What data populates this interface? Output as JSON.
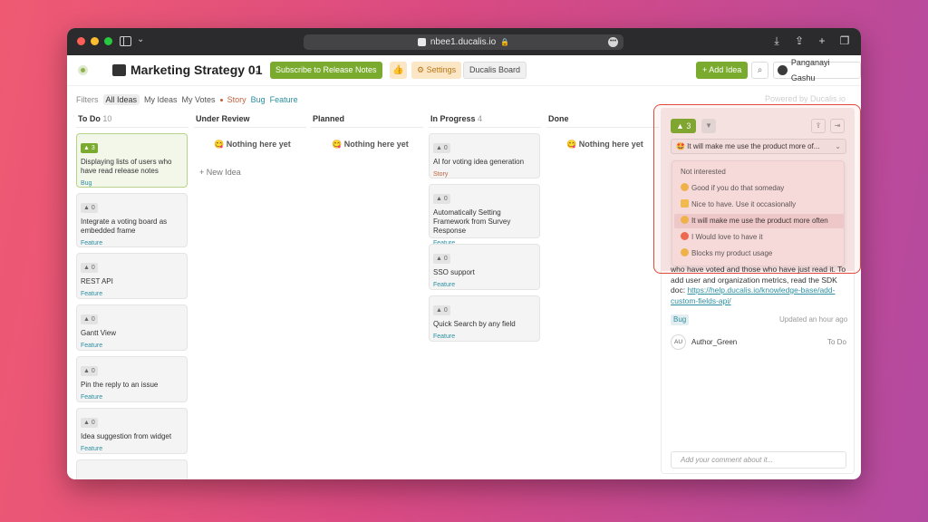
{
  "browser": {
    "url": "nbee1.ducalis.io",
    "light_colors": [
      "#ff5f57",
      "#febc2e",
      "#28c840"
    ]
  },
  "header": {
    "board_title": "Marketing Strategy 01",
    "subscribe_label": "Subscribe to Release Notes",
    "settings_label": "Settings",
    "ducalis_board_label": "Ducalis Board",
    "add_idea_label": "+ Add Idea",
    "user_name": "Panganayi Gashu"
  },
  "filters": {
    "label": "Filters",
    "all_ideas": "All Ideas",
    "my_ideas": "My Ideas",
    "my_votes": "My Votes",
    "story": "Story",
    "bug": "Bug",
    "feature": "Feature",
    "powered_by": "Powered by  Ducalis.io"
  },
  "columns": {
    "todo": {
      "title": "To Do",
      "count": "10"
    },
    "under_review": {
      "title": "Under Review",
      "count": ""
    },
    "planned": {
      "title": "Planned",
      "count": ""
    },
    "in_progress": {
      "title": "In Progress",
      "count": "4"
    },
    "done": {
      "title": "Done",
      "count": ""
    }
  },
  "empty_label": "😋 Nothing here yet",
  "new_idea_label": "+  New Idea",
  "todo_cards": [
    {
      "votes": "▲ 3",
      "title": "Displaying lists of users who have read release notes",
      "tag": "Bug"
    },
    {
      "votes": "▲ 0",
      "title": "Integrate a voting board as embedded frame",
      "tag": "Feature"
    },
    {
      "votes": "▲ 0",
      "title": "REST API",
      "tag": "Feature"
    },
    {
      "votes": "▲ 0",
      "title": "Gantt View",
      "tag": "Feature"
    },
    {
      "votes": "▲ 0",
      "title": "Pin the reply to an issue",
      "tag": "Feature"
    },
    {
      "votes": "▲ 0",
      "title": "Idea suggestion from widget",
      "tag": "Feature"
    }
  ],
  "progress_cards": [
    {
      "votes": "▲ 0",
      "title": "AI for voting idea generation",
      "tag": "Story"
    },
    {
      "votes": "▲ 0",
      "title": "Automatically Setting Framework from Survey Response",
      "tag": "Feature"
    },
    {
      "votes": "▲ 0",
      "title": "SSO support",
      "tag": "Feature"
    },
    {
      "votes": "▲ 0",
      "title": "Quick Search by any field",
      "tag": "Feature"
    }
  ],
  "panel": {
    "vote_label": "▲ 3",
    "selected_option": "🤩 It will make me use the product more of...",
    "menu": [
      {
        "label": "Not interested",
        "emoji": ""
      },
      {
        "label": "Good if you do that someday",
        "emoji": "smile"
      },
      {
        "label": "Nice to have. Use it occasionally",
        "emoji": "thumb"
      },
      {
        "label": "It will make me use the product more often",
        "emoji": "star"
      },
      {
        "label": "I Would love to have it",
        "emoji": "love"
      },
      {
        "label": "Blocks my product usage",
        "emoji": "smile"
      }
    ],
    "desc_text": "who have voted and those who have just read it. To add user and organization metrics, read the SDK doc: ",
    "desc_link": "https://help.ducalis.io/knowledge-base/add-custom-fields-api/",
    "tag": "Bug",
    "updated": "Updated an hour ago",
    "author_initials": "AU",
    "author": "Author_Green",
    "status": "To Do",
    "comment_placeholder": "Add your comment about it..."
  }
}
